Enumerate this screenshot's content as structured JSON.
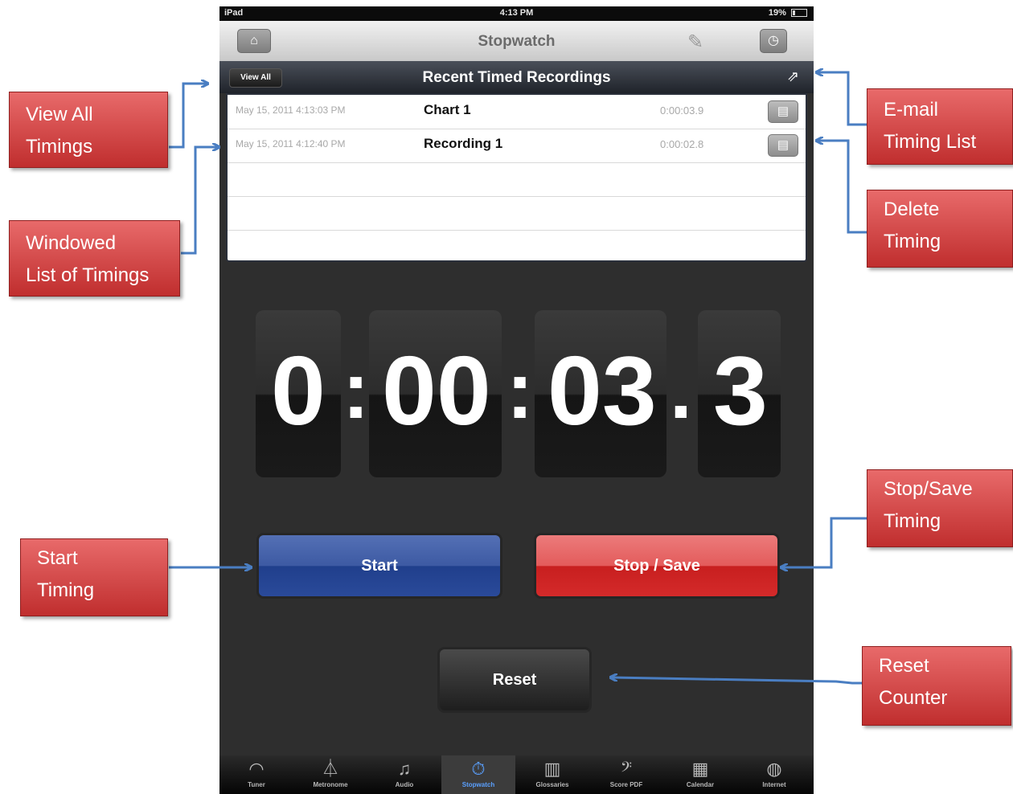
{
  "statusbar": {
    "device": "iPad",
    "time": "4:13 PM",
    "battery": "19%"
  },
  "navbar": {
    "title": "Stopwatch",
    "home_icon": "home-icon",
    "edit_icon": "pencil-icon",
    "timer_icon": "timer-icon"
  },
  "recordings": {
    "title": "Recent Timed Recordings",
    "view_all_label": "View All",
    "share_icon": "share-icon",
    "rows": [
      {
        "date": "May 15, 2011 4:13:03 PM",
        "name": "Chart 1",
        "duration": "0:00:03.9"
      },
      {
        "date": "May 15, 2011 4:12:40 PM",
        "name": "Recording 1",
        "duration": "0:00:02.8"
      }
    ]
  },
  "timer": {
    "hours": "0",
    "minutes": "00",
    "seconds": "03",
    "tenths": "3",
    "sep1": ":",
    "sep2": ":",
    "sep3": "."
  },
  "controls": {
    "start_label": "Start",
    "stop_label": "Stop / Save",
    "reset_label": "Reset"
  },
  "colors": {
    "start": "#2f4e9b",
    "stop": "#d42a2a",
    "callout": "#c9393a",
    "arrow": "#4a7ec2"
  },
  "tabs": [
    {
      "label": "Tuner",
      "icon": "tuner-icon"
    },
    {
      "label": "Metronome",
      "icon": "metronome-icon"
    },
    {
      "label": "Audio",
      "icon": "music-note-icon"
    },
    {
      "label": "Stopwatch",
      "icon": "stopwatch-icon",
      "active": true
    },
    {
      "label": "Glossaries",
      "icon": "book-icon"
    },
    {
      "label": "Score PDF",
      "icon": "bass-clef-icon"
    },
    {
      "label": "Calendar",
      "icon": "calendar-icon"
    },
    {
      "label": "Internet",
      "icon": "globe-icon"
    }
  ],
  "callouts": {
    "view_all": [
      "View All",
      "Timings"
    ],
    "windowed": [
      "Windowed",
      "List of Timings"
    ],
    "start": [
      "Start",
      "Timing"
    ],
    "email": [
      "E-mail",
      "Timing List"
    ],
    "delete": [
      "Delete",
      "Timing"
    ],
    "stop": [
      "Stop/Save",
      "Timing"
    ],
    "reset": [
      "Reset",
      "Counter"
    ]
  }
}
